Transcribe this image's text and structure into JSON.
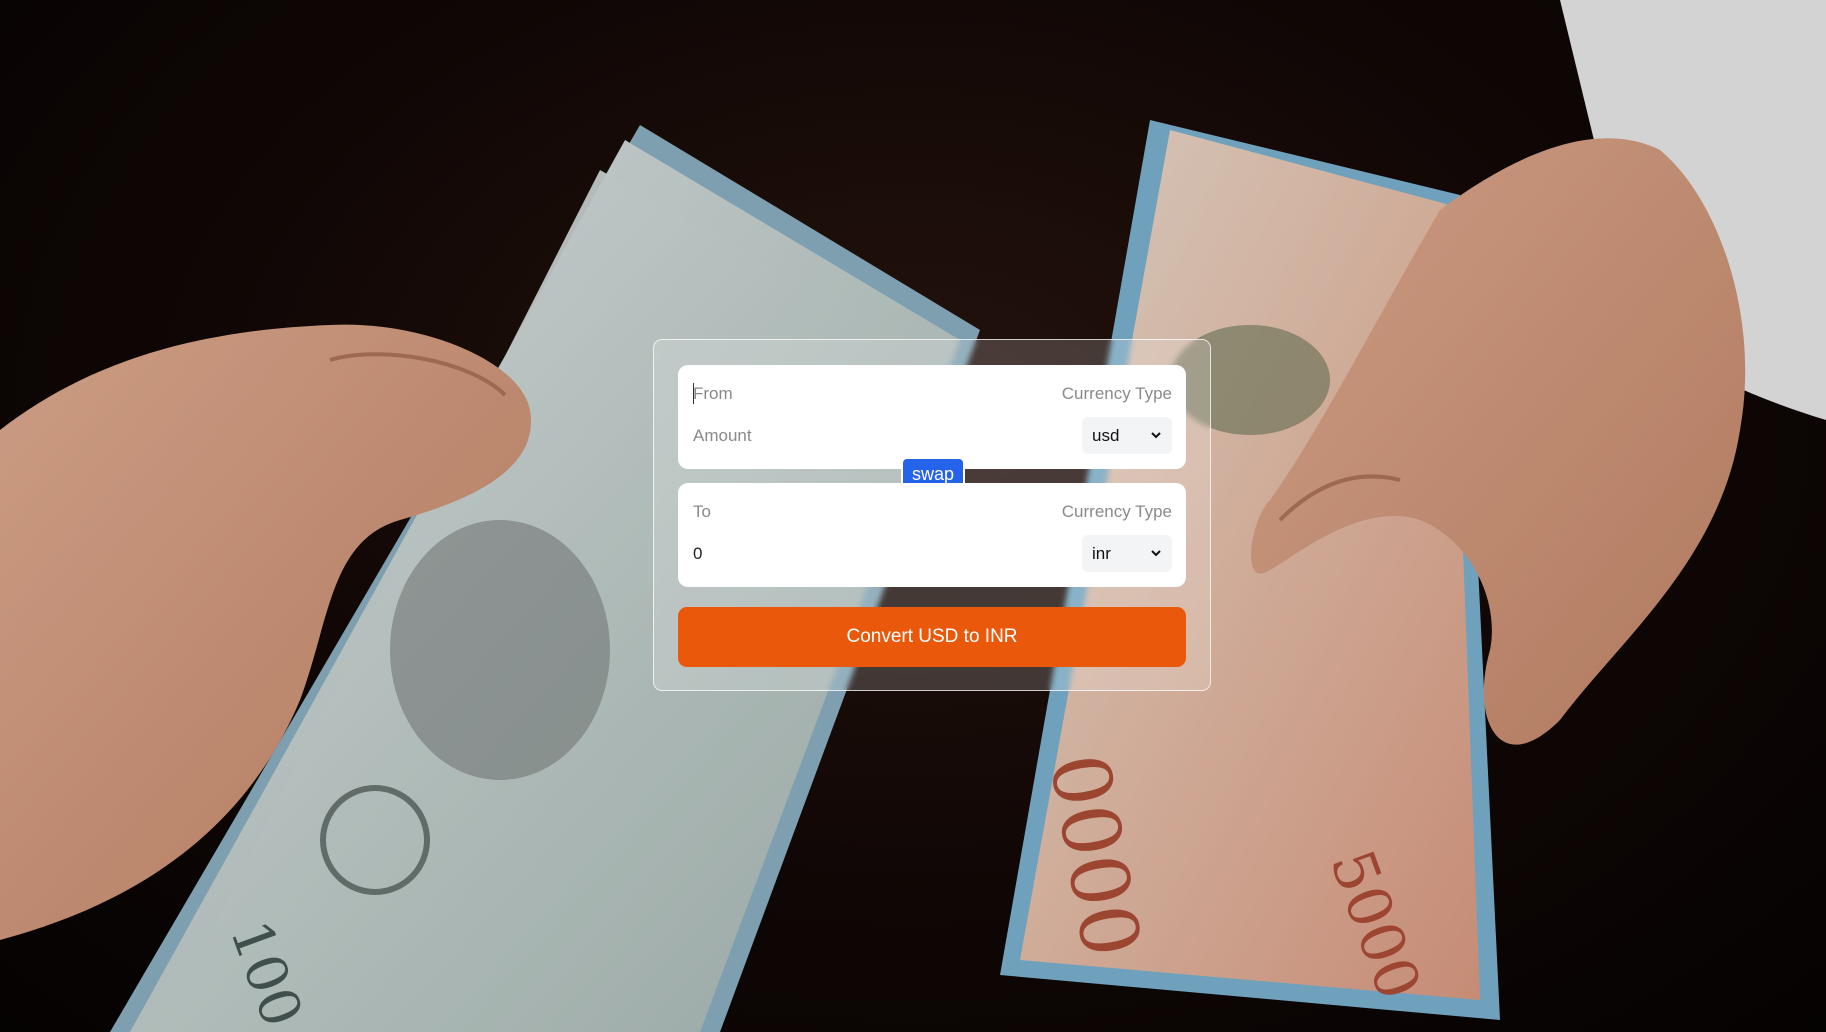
{
  "converter": {
    "from_label": "From",
    "from_currency_type_label": "Currency Type",
    "from_amount_placeholder": "Amount",
    "from_currency": "usd",
    "swap_label": "swap",
    "to_label": "To",
    "to_currency_type_label": "Currency Type",
    "to_amount": "0",
    "to_currency": "inr",
    "convert_label": "Convert USD to INR"
  },
  "colors": {
    "swap_button": "#2563eb",
    "convert_button": "#ea580c"
  },
  "icons": [
    "chevron-down-icon"
  ]
}
